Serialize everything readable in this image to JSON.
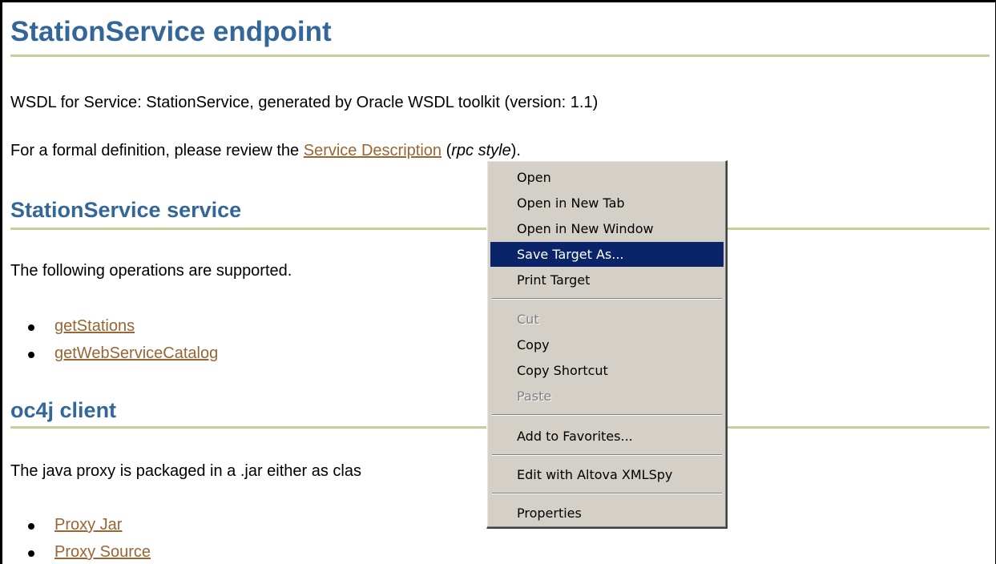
{
  "page": {
    "title": "StationService endpoint",
    "intro_text": "WSDL for Service: StationService, generated by Oracle WSDL toolkit (version: 1.1)",
    "formal_prefix": "For a formal definition, please review the ",
    "service_description_link": "Service Description",
    "formal_open_paren": " (",
    "formal_style": "rpc style",
    "formal_suffix": ")."
  },
  "service_section": {
    "heading": "StationService service",
    "text": "The following operations are supported.",
    "operations": [
      "getStations",
      "getWebServiceCatalog"
    ]
  },
  "client_section": {
    "heading": "oc4j client",
    "text": "The java proxy is packaged in a .jar either as clas",
    "links": [
      "Proxy Jar",
      "Proxy Source"
    ]
  },
  "context_menu": {
    "items": [
      {
        "label": "Open",
        "state": "normal"
      },
      {
        "label": "Open in New Tab",
        "state": "normal"
      },
      {
        "label": "Open in New Window",
        "state": "normal"
      },
      {
        "label": "Save Target As...",
        "state": "selected"
      },
      {
        "label": "Print Target",
        "state": "normal"
      },
      {
        "label": "Cut",
        "state": "disabled"
      },
      {
        "label": "Copy",
        "state": "normal"
      },
      {
        "label": "Copy Shortcut",
        "state": "normal"
      },
      {
        "label": "Paste",
        "state": "disabled"
      },
      {
        "label": "Add to Favorites...",
        "state": "normal"
      },
      {
        "label": "Edit with Altova XMLSpy",
        "state": "normal"
      },
      {
        "label": "Properties",
        "state": "normal"
      }
    ]
  },
  "colors": {
    "heading": "#336699",
    "link": "#996633",
    "rule": "#cccc99",
    "menu_background": "#d4d0c8",
    "menu_highlight": "#0a246a"
  }
}
